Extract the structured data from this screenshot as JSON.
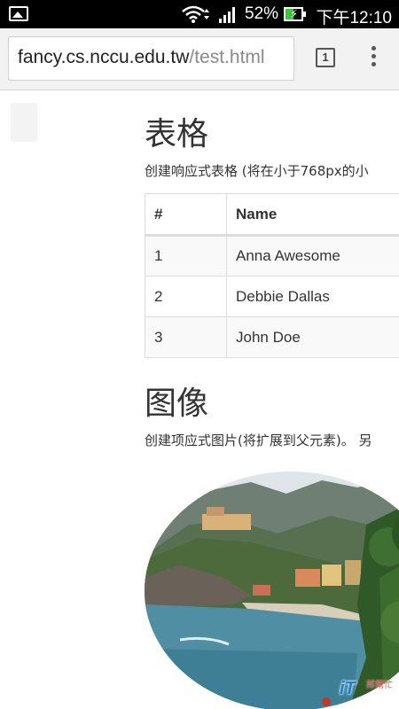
{
  "status_bar": {
    "battery_percent": "52%",
    "time": "下午12:10",
    "battery_level": 0.52,
    "icons": [
      "gallery-icon",
      "wifi-icon",
      "signal-icon",
      "battery-charging-icon"
    ]
  },
  "browser": {
    "url_host": "fancy.cs.nccu.edu.tw",
    "url_path": "/test.html",
    "tab_count": "1"
  },
  "content": {
    "tables_heading": "表格",
    "tables_lead": "创建响应式表格 (将在小于768px的小",
    "table": {
      "headers": [
        "#",
        "Name"
      ],
      "rows": [
        [
          "1",
          "Anna Awesome"
        ],
        [
          "2",
          "Debbie Dallas"
        ],
        [
          "3",
          "John Doe"
        ]
      ]
    },
    "images_heading": "图像",
    "images_lead": "创建项应式图片(将扩展到父元素)。 另"
  },
  "watermark": {
    "brand": "iT",
    "tagline": "邦幫忙"
  },
  "colors": {
    "status_bg": "#000000",
    "battery_green": "#3fc33f",
    "url_path_gray": "#8a8a8a",
    "table_border": "#dddddd",
    "stripe": "#f9f9f9"
  }
}
